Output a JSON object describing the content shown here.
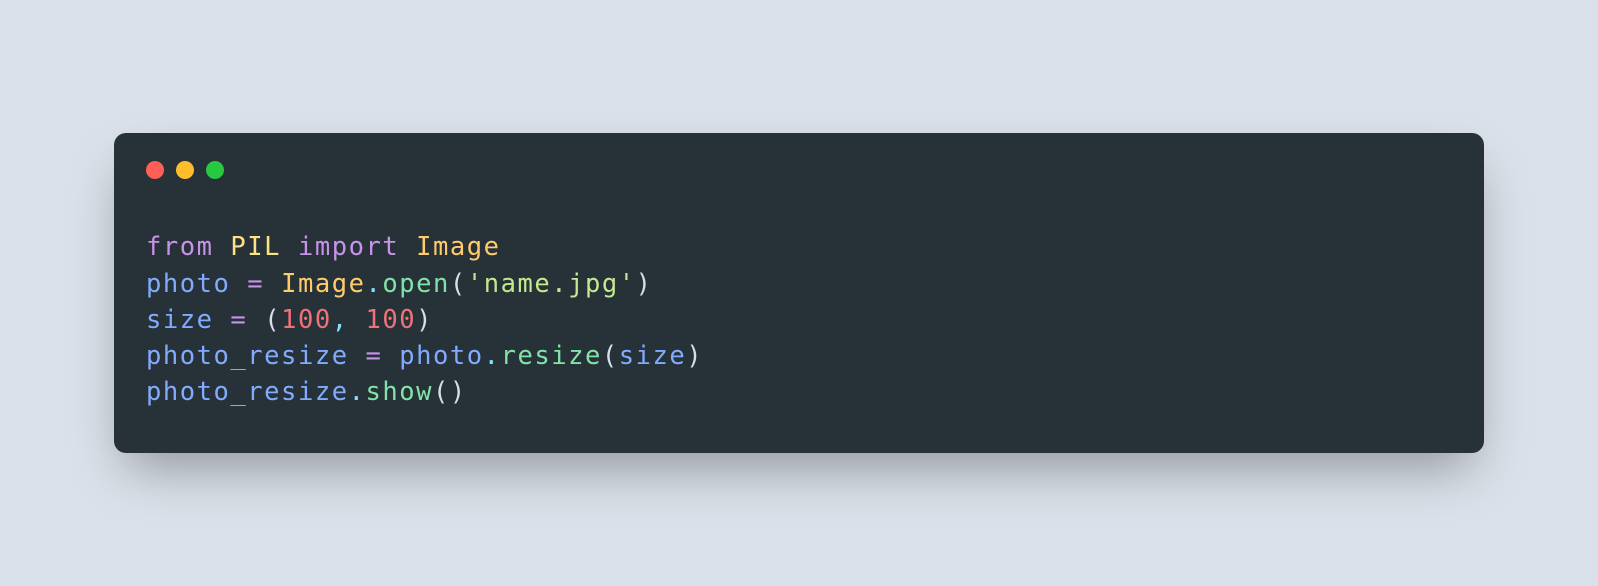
{
  "code": {
    "line1": {
      "from": "from",
      "module": "PIL",
      "import": "import",
      "name": "Image"
    },
    "line3": {
      "var": "photo",
      "eq": " = ",
      "cls": "Image",
      "dot": ".",
      "method": "open",
      "lparen": "(",
      "str": "'name.jpg'",
      "rparen": ")"
    },
    "line4": {
      "var": "size",
      "eq": " = ",
      "lparen": "(",
      "num1": "100",
      "comma": ", ",
      "num2": "100",
      "rparen": ")"
    },
    "line5": {
      "var": "photo_resize",
      "eq": " = ",
      "obj": "photo",
      "dot": ".",
      "method": "resize",
      "lparen": "(",
      "arg": "size",
      "rparen": ")"
    },
    "line6": {
      "obj": "photo_resize",
      "dot": ".",
      "method": "show",
      "lparen": "(",
      "rparen": ")"
    }
  },
  "colors": {
    "background": "#dbe1ea",
    "window": "#263238",
    "red": "#ff5f56",
    "yellow": "#ffbd2e",
    "green": "#27c93f"
  }
}
